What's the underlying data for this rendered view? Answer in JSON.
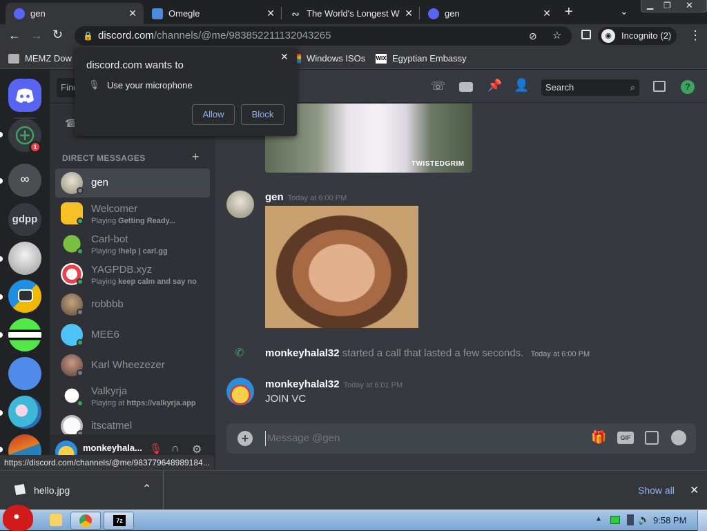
{
  "tabs": [
    {
      "title": "gen",
      "fav_color": "#5865f2"
    },
    {
      "title": "Omegle",
      "fav_color": "#4a8bdb"
    },
    {
      "title": "The World's Longest W",
      "fav_color": "#9aa0a6"
    },
    {
      "title": "gen",
      "fav_color": "#5865f2"
    }
  ],
  "toolbar": {
    "url_host": "discord.com",
    "url_path": "/channels/@me/983852211132043265",
    "profile_label": "Incognito (2)"
  },
  "bookmarks": [
    {
      "label": "MEMZ Dow"
    },
    {
      "label": "Windows ISOs"
    },
    {
      "label": "Egyptian Embassy"
    }
  ],
  "permission": {
    "title": "discord.com wants to",
    "item": "Use your microphone",
    "allow": "Allow",
    "block": "Block"
  },
  "guilds": {
    "badge": "1",
    "text_guild": "gdpp"
  },
  "channels": {
    "search_placeholder": "Find",
    "section_title": "DIRECT MESSAGES",
    "dms": [
      {
        "name": "gen",
        "status": "",
        "activity": ""
      },
      {
        "name": "Welcomer",
        "status": "Playing",
        "activity": "Getting Ready..."
      },
      {
        "name": "Carl-bot",
        "status": "Playing",
        "activity": "!help | carl.gg"
      },
      {
        "name": "YAGPDB.xyz",
        "status": "Playing",
        "activity": "keep calm and say no"
      },
      {
        "name": "robbbb",
        "status": "",
        "activity": ""
      },
      {
        "name": "MEE6",
        "status": "",
        "activity": ""
      },
      {
        "name": "Karl Wheezezer",
        "status": "",
        "activity": ""
      },
      {
        "name": "Valkyrja",
        "status": "Playing at",
        "activity": "https://valkyrja.app"
      },
      {
        "name": "itscatmel",
        "status": "",
        "activity": ""
      }
    ],
    "user_name": "monkeyhala..."
  },
  "chat": {
    "search_placeholder": "Search",
    "image_watermark": "TWISTEDGRIM",
    "messages": [
      {
        "author": "gen",
        "time": "Today at 6:00 PM"
      },
      {
        "call_author": "monkeyhalal32",
        "call_text": "started a call that lasted a few seconds.",
        "time": "Today at 6:00 PM"
      },
      {
        "author": "monkeyhalal32",
        "time": "Today at 6:01 PM",
        "text": "JOIN VC"
      }
    ],
    "composer_placeholder": "Message @gen"
  },
  "status_url": "https://discord.com/channels/@me/983779648989184...",
  "downloads": {
    "file": "hello.jpg",
    "show_all": "Show all"
  },
  "taskbar": {
    "clock": "9:58 PM"
  },
  "colors": {
    "blurple": "#5865f2",
    "online": "#3ba55d",
    "offline": "#747f8d",
    "green_help": "#3ba55d"
  }
}
